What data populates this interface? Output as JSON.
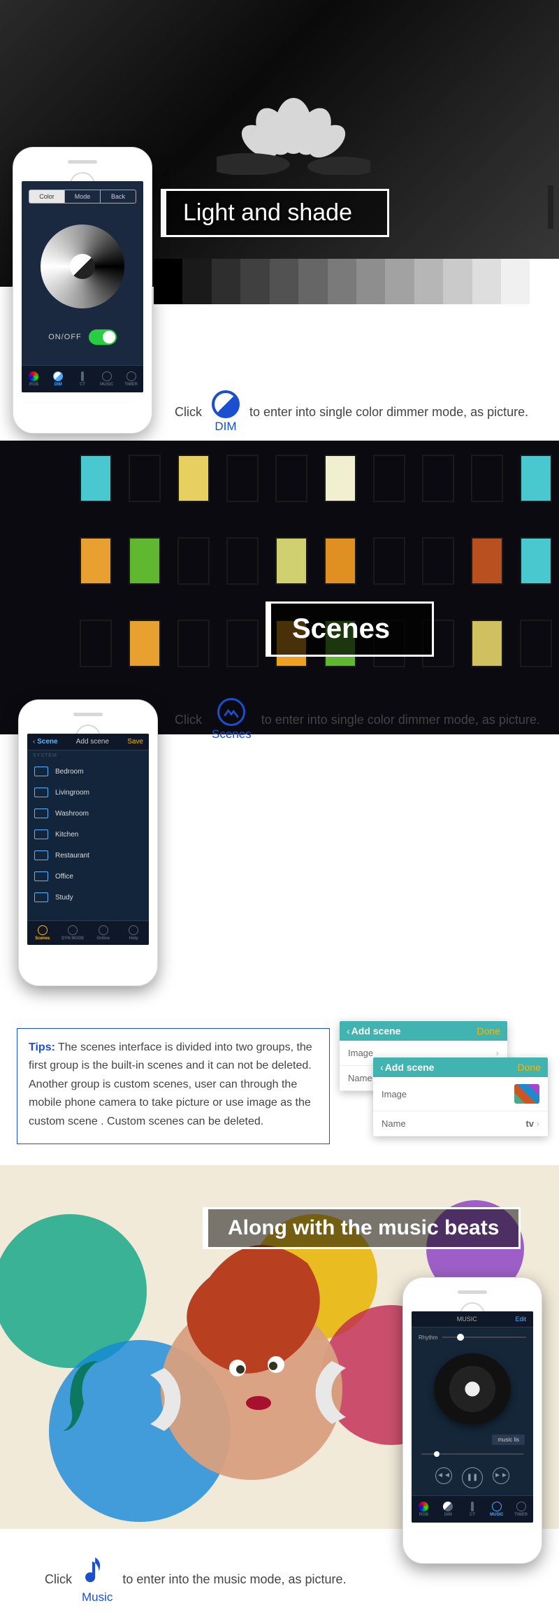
{
  "section1": {
    "title": "Light and shade",
    "phone": {
      "tabs": {
        "a": "Color",
        "b": "Mode",
        "c": "Back"
      },
      "onoff": "ON/OFF",
      "nav": {
        "rgb": "RGB",
        "dim": "DIM",
        "ct": "CT",
        "music": "MUSIC",
        "timer": "TIMER"
      }
    },
    "click": "Click",
    "icon_label": "DIM",
    "instruction": "to enter into single color dimmer mode, as picture."
  },
  "section2": {
    "title": "Scenes",
    "phone": {
      "back": "Scene",
      "title": "Add scene",
      "save": "Save",
      "cat": "SYSTEM",
      "items": [
        "Bedroom",
        "Livingroom",
        "Washroom",
        "Kitchen",
        "Restaurant",
        "Office",
        "Study"
      ],
      "nav": {
        "scenes": "Scenes",
        "dyn": "DYN MODE",
        "online": "Online",
        "help": "Help"
      }
    },
    "click": "Click",
    "icon_label": "Scenes",
    "instruction": "to enter into single color dimmer mode, as picture.",
    "tips_label": "Tips:",
    "tips": "The scenes interface is divided into two groups, the first group is the built-in scenes and it can not be deleted. Another group is custom scenes, user can through the mobile phone camera to take picture or use image as the custom scene . Custom scenes can be deleted.",
    "card": {
      "back": "Add scene",
      "done": "Done",
      "image": "Image",
      "name": "Name",
      "name_val": "tv"
    }
  },
  "section3": {
    "title": "Along with the music beats",
    "phone": {
      "title": "MUSIC",
      "edit": "Edit",
      "rhythm": "Rhythm",
      "song": "music lis",
      "nav": {
        "rgb": "RGB",
        "dim": "DIM",
        "ct": "CT",
        "music": "MUSIC",
        "timer": "TIMER"
      }
    },
    "click": "Click",
    "icon_label": "Music",
    "instruction": "to enter into the music mode, as picture."
  },
  "gradient_steps": [
    "#000000",
    "#1a1a1a",
    "#2e2e2e",
    "#404040",
    "#525252",
    "#666666",
    "#7a7a7a",
    "#8e8e8e",
    "#a2a2a2",
    "#b6b6b6",
    "#cacaca",
    "#dedede",
    "#f0f0f0",
    "#ffffff"
  ]
}
